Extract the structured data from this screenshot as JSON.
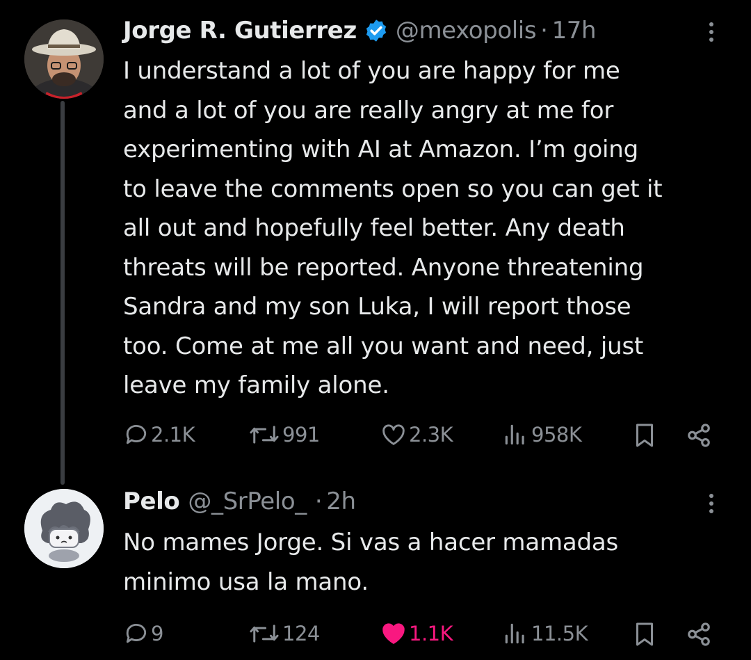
{
  "tweets": [
    {
      "author_name": "Jorge R. Gutierrez",
      "verified": true,
      "handle": "@mexopolis",
      "separator": "·",
      "time": "17h",
      "lines": [
        "I understand a lot of you are happy for me",
        "and a lot of you are really angry at me for",
        "experimenting with AI at Amazon. I’m going",
        "to leave the comments open so you can get it",
        "all out and hopefully feel better. Any death",
        "threats will be reported. Anyone threatening",
        "Sandra and my son Luka, I will report those",
        "too. Come at me all you want and need, just",
        "leave my family alone."
      ],
      "replies": "2.1K",
      "reposts": "991",
      "likes": "2.3K",
      "views": "958K",
      "liked": false
    },
    {
      "author_name": "Pelo",
      "verified": false,
      "handle": "@_SrPelo_",
      "separator": "·",
      "time": "2h",
      "lines": [
        "No mames Jorge. Si vas a hacer mamadas",
        "minimo usa la mano."
      ],
      "replies": "9",
      "reposts": "124",
      "likes": "1.1K",
      "views": "11.5K",
      "liked": true
    }
  ],
  "colors": {
    "background": "#000000",
    "text": "#e7e9ea",
    "muted": "#8b9096",
    "verified": "#1d9bf0",
    "like": "#f91880",
    "thread_line": "#3a3d41"
  },
  "icons": [
    "more-icon",
    "verified-badge-icon",
    "reply-icon",
    "repost-icon",
    "like-icon",
    "views-icon",
    "bookmark-icon",
    "share-icon"
  ]
}
